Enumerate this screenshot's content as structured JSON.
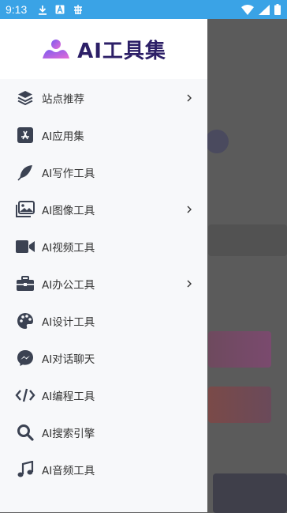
{
  "status_bar": {
    "time": "9:13"
  },
  "drawer": {
    "logo_text": "AI工具集",
    "items": [
      {
        "label": "站点推荐",
        "icon": "layers-icon",
        "has_submenu": true
      },
      {
        "label": "AI应用集",
        "icon": "app-store-icon",
        "has_submenu": false
      },
      {
        "label": "AI写作工具",
        "icon": "feather-icon",
        "has_submenu": false
      },
      {
        "label": "AI图像工具",
        "icon": "images-icon",
        "has_submenu": true
      },
      {
        "label": "AI视频工具",
        "icon": "video-camera-icon",
        "has_submenu": false
      },
      {
        "label": "AI办公工具",
        "icon": "briefcase-icon",
        "has_submenu": true
      },
      {
        "label": "AI设计工具",
        "icon": "palette-icon",
        "has_submenu": false
      },
      {
        "label": "AI对话聊天",
        "icon": "messenger-icon",
        "has_submenu": false
      },
      {
        "label": "AI编程工具",
        "icon": "code-icon",
        "has_submenu": false
      },
      {
        "label": "AI搜索引擎",
        "icon": "search-icon",
        "has_submenu": false
      },
      {
        "label": "AI音频工具",
        "icon": "music-icon",
        "has_submenu": false
      }
    ]
  },
  "colors": {
    "status_bar": "#3aa3e6",
    "icon": "#3b4252",
    "logo_text": "#2c1f67",
    "logo_gradient_start": "#7b5cf0",
    "logo_gradient_end": "#e46bd6"
  }
}
